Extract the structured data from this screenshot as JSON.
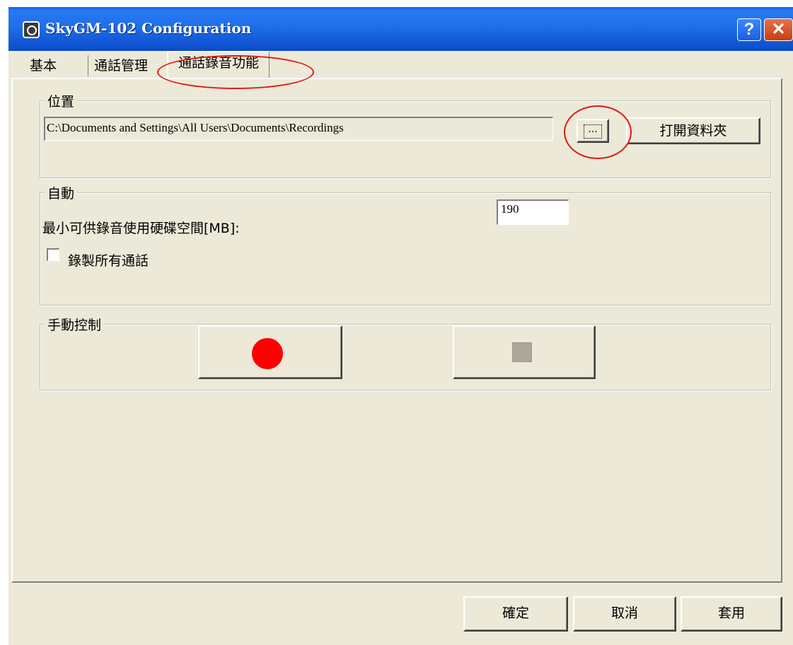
{
  "window": {
    "title": "SkyGM-102 Configuration",
    "help_label": "?",
    "close_label": "✕"
  },
  "tabs": [
    {
      "label": "基本"
    },
    {
      "label": "通話管理"
    },
    {
      "label": "通話錄音功能"
    }
  ],
  "location": {
    "group_label": "位置",
    "path_value": "C:\\Documents and Settings\\All Users\\Documents\\Recordings",
    "browse_label": "...",
    "open_folder_label": "打開資料夾"
  },
  "auto": {
    "group_label": "自動",
    "min_space_label": "最小可供錄音使用硬碟空間[MB]:",
    "min_space_value": "190",
    "record_all_label": "錄製所有通話",
    "record_all_checked": false
  },
  "manual": {
    "group_label": "手動控制",
    "record_icon": "record-icon",
    "stop_icon": "stop-icon"
  },
  "footer": {
    "ok_label": "確定",
    "cancel_label": "取消",
    "apply_label": "套用"
  },
  "annotation_color": "#e01818"
}
